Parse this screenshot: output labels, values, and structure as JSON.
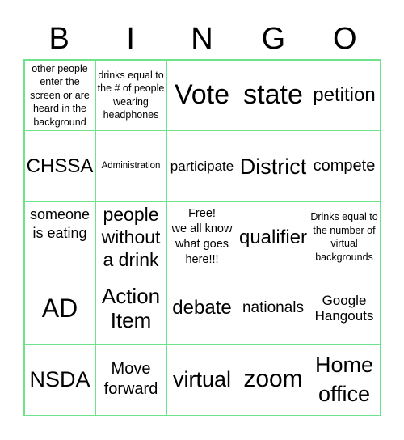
{
  "header": [
    "B",
    "I",
    "N",
    "G",
    "O"
  ],
  "cells": [
    "other people enter the screen or are heard in the background",
    "drinks equal to the # of people wearing headphones",
    "Vote",
    "state",
    "petition",
    "CHSSA",
    "Administration",
    "participate",
    "District",
    "compete",
    "someone is eating",
    "people without a drink",
    "Free!\nwe all know what goes here!!!",
    "qualifier",
    "Drinks equal to the number of virtual backgrounds",
    "AD",
    "Action Item",
    "debate",
    "nationals",
    "Google Hangouts",
    "NSDA",
    "Move forward",
    "virtual",
    "zoom",
    "Home office"
  ],
  "colors": {
    "grid_border": "#6fe38c",
    "text": "#000000",
    "background": "#ffffff"
  }
}
